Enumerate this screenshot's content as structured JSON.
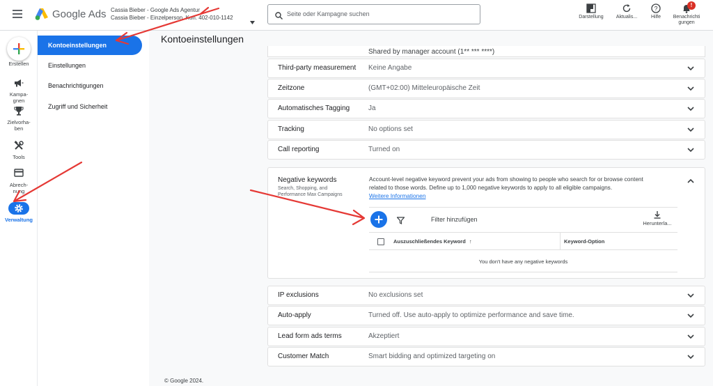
{
  "header": {
    "product_name": "Google Ads",
    "account_line1": "Cassia Bieber - Google Ads Agentur",
    "account_line2": "Cassia Bieber - Einzelperson, Kon. 402-010-1142",
    "search_placeholder": "Seite oder Kampagne suchen",
    "tools": [
      {
        "label": "Darstellung",
        "icon": "appearance-icon"
      },
      {
        "label": "Aktualis...",
        "icon": "refresh-icon"
      },
      {
        "label": "Hilfe",
        "icon": "help-icon"
      },
      {
        "label_line1": "Benachrichti",
        "label_line2": "gungen",
        "icon": "bell-icon",
        "badge": "!"
      }
    ]
  },
  "rail": {
    "create": "Erstellen",
    "items": [
      {
        "line1": "Kampa-",
        "line2": "gnen",
        "icon": "megaphone-icon"
      },
      {
        "line1": "Zielvorha-",
        "line2": "ben",
        "icon": "trophy-icon"
      },
      {
        "line1": "Tools",
        "line2": "",
        "icon": "tools-icon"
      },
      {
        "line1": "Abrech-",
        "line2": "nung",
        "icon": "billing-icon"
      },
      {
        "line1": "Verwaltung",
        "line2": "",
        "icon": "gear-icon"
      }
    ]
  },
  "subnav": {
    "items": [
      "Kontoeinstellungen",
      "Einstellungen",
      "Benachrichtigungen",
      "Zugriff und Sicherheit"
    ]
  },
  "page": {
    "title": "Kontoeinstellungen",
    "shared_note": "Shared by manager account (1** *** ****)",
    "footer": "© Google 2024."
  },
  "settings_top": [
    {
      "label": "Third-party measurement",
      "value": "Keine Angabe"
    },
    {
      "label": "Zeitzone",
      "value": "(GMT+02:00) Mitteleuropäische Zeit"
    },
    {
      "label": "Automatisches Tagging",
      "value": "Ja"
    },
    {
      "label": "Tracking",
      "value": "No options set"
    },
    {
      "label": "Call reporting",
      "value": "Turned on"
    }
  ],
  "negative_keywords": {
    "title": "Negative keywords",
    "subtitle_line1": "Search, Shopping, and",
    "subtitle_line2": "Performance Max Campaigns",
    "desc_line1": "Account-level negative keyword prevent your ads from showing to people who search for or browse content",
    "desc_line2": "related to those words. Define up to 1,000 negative keywords to apply to all eligible campaigns.",
    "learn_more": "Weitere Informationen",
    "filter_placeholder": "Filter hinzufügen",
    "download": "Herunterla...",
    "col_keyword": "Auszuschließendes Keyword",
    "col_option": "Keyword-Option",
    "empty": "You don't have any negative keywords"
  },
  "settings_bottom": [
    {
      "label": "IP exclusions",
      "value": "No exclusions set"
    },
    {
      "label": "Auto-apply",
      "value": "Turned off. Use auto-apply to optimize performance and save time."
    },
    {
      "label": "Lead form ads terms",
      "value": "Akzeptiert"
    },
    {
      "label": "Customer Match",
      "value": "Smart bidding and optimized targeting on"
    }
  ],
  "colors": {
    "accent": "#1a73e8",
    "annotation": "#e53935"
  }
}
